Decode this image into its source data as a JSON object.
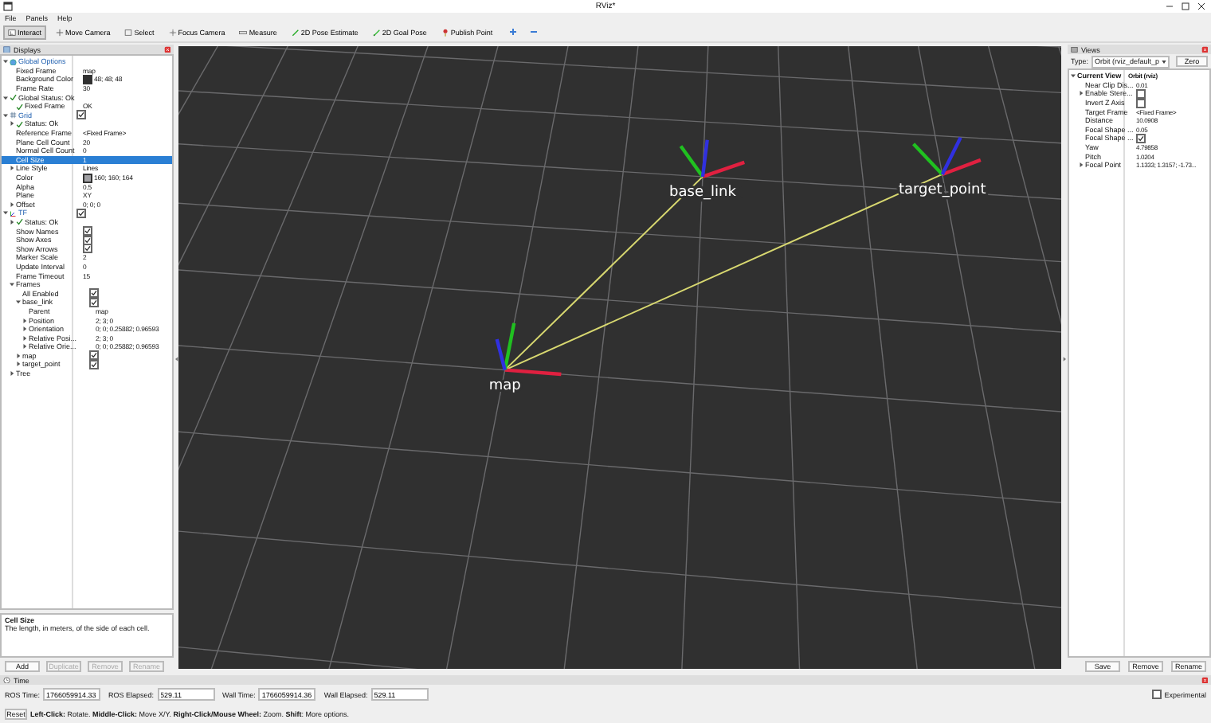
{
  "window": {
    "title": "RViz*"
  },
  "menu": [
    "File",
    "Panels",
    "Help"
  ],
  "toolbar": [
    {
      "label": "Interact",
      "kind": "interact",
      "selected": true
    },
    {
      "label": "Move Camera",
      "kind": "move",
      "selected": false
    },
    {
      "label": "Select",
      "kind": "select",
      "selected": false
    },
    {
      "label": "Focus Camera",
      "kind": "focus",
      "selected": false
    },
    {
      "label": "Measure",
      "kind": "measure",
      "selected": false
    },
    {
      "label": "2D Pose Estimate",
      "kind": "pose",
      "selected": false
    },
    {
      "label": "2D Goal Pose",
      "kind": "goal",
      "selected": false
    },
    {
      "label": "Publish Point",
      "kind": "point",
      "selected": false
    }
  ],
  "toolbar_extra": [
    {
      "kind": "add"
    },
    {
      "kind": "remove"
    }
  ],
  "displays": {
    "title": "Displays",
    "tree": [
      {
        "label": "Global Options",
        "kind": "globe",
        "expanded": true,
        "selected": false,
        "children": [
          {
            "label": "Fixed Frame",
            "value": "map",
            "selected": false
          },
          {
            "label": "Background Color",
            "value": "48; 48; 48",
            "color": "#303030",
            "selected": false
          },
          {
            "label": "Frame Rate",
            "value": "30",
            "selected": false
          }
        ]
      },
      {
        "label": "Global Status: Ok",
        "kind": "status",
        "expanded": true,
        "selected": false,
        "children": [
          {
            "label": "Fixed Frame",
            "kind": "status",
            "value": "OK",
            "selected": false
          }
        ]
      },
      {
        "label": "Grid",
        "kind": "grid",
        "expanded": true,
        "checked": true,
        "selected": false,
        "children": [
          {
            "label": "Status: Ok",
            "kind": "status",
            "expanded": false,
            "selected": false
          },
          {
            "label": "Reference Frame",
            "value": "<Fixed Frame>",
            "selected": false
          },
          {
            "label": "Plane Cell Count",
            "value": "20",
            "selected": false
          },
          {
            "label": "Normal Cell Count",
            "value": "0",
            "selected": false
          },
          {
            "label": "Cell Size",
            "value": "1",
            "selected": true
          },
          {
            "label": "Line Style",
            "value": "Lines",
            "expanded": false,
            "selected": false
          },
          {
            "label": "Color",
            "value": "160; 160; 164",
            "color": "#a0a0a4",
            "selected": false
          },
          {
            "label": "Alpha",
            "value": "0.5",
            "selected": false
          },
          {
            "label": "Plane",
            "value": "XY",
            "selected": false
          },
          {
            "label": "Offset",
            "value": "0; 0; 0",
            "expanded": false,
            "selected": false
          }
        ]
      },
      {
        "label": "TF",
        "kind": "tf",
        "expanded": true,
        "checked": true,
        "selected": false,
        "children": [
          {
            "label": "Status: Ok",
            "kind": "status",
            "expanded": false,
            "selected": false
          },
          {
            "label": "Show Names",
            "checked": true,
            "selected": false
          },
          {
            "label": "Show Axes",
            "checked": true,
            "selected": false
          },
          {
            "label": "Show Arrows",
            "checked": true,
            "selected": false
          },
          {
            "label": "Marker Scale",
            "value": "2",
            "selected": false
          },
          {
            "label": "Update Interval",
            "value": "0",
            "selected": false
          },
          {
            "label": "Frame Timeout",
            "value": "15",
            "selected": false
          },
          {
            "label": "Frames",
            "expanded": true,
            "selected": false,
            "children": [
              {
                "label": "All Enabled",
                "checked": true,
                "selected": false
              },
              {
                "label": "base_link",
                "checked": true,
                "expanded": true,
                "selected": false,
                "children": [
                  {
                    "label": "Parent",
                    "value": "map",
                    "selected": false
                  },
                  {
                    "label": "Position",
                    "value": "2; 3; 0",
                    "expanded": false,
                    "selected": false
                  },
                  {
                    "label": "Orientation",
                    "value": "0; 0; 0.25882; 0.96593",
                    "expanded": false,
                    "selected": false
                  },
                  {
                    "label": "Relative Posi...",
                    "value": "2; 3; 0",
                    "expanded": false,
                    "selected": false
                  },
                  {
                    "label": "Relative Orie...",
                    "value": "0; 0; 0.25882; 0.96593",
                    "expanded": false,
                    "selected": false
                  }
                ]
              },
              {
                "label": "map",
                "checked": true,
                "expanded": false,
                "selected": false
              },
              {
                "label": "target_point",
                "checked": true,
                "expanded": false,
                "selected": false
              }
            ]
          },
          {
            "label": "Tree",
            "expanded": false,
            "selected": false
          }
        ]
      }
    ],
    "help_title": "Cell Size",
    "help_text": "The length, in meters, of the side of each cell.",
    "buttons": [
      {
        "label": "Add",
        "disabled": false
      },
      {
        "label": "Duplicate",
        "disabled": true
      },
      {
        "label": "Remove",
        "disabled": true
      },
      {
        "label": "Rename",
        "disabled": true
      }
    ]
  },
  "scene": {
    "frame_labels": [
      "base_link",
      "target_point",
      "map"
    ]
  },
  "views": {
    "title": "Views",
    "type_label": "Type:",
    "type_value": "Orbit (rviz_default_p",
    "zero_button": "Zero",
    "tree": [
      {
        "label": "Current View",
        "value": "Orbit (rviz)",
        "expanded": true,
        "selected": false,
        "children": [
          {
            "label": "Near Clip Dis...",
            "value": "0.01",
            "selected": false
          },
          {
            "label": "Enable Stere...",
            "checked": false,
            "expanded": false,
            "selected": false
          },
          {
            "label": "Invert Z Axis",
            "checked": false,
            "selected": false
          },
          {
            "label": "Target Frame",
            "value": "<Fixed Frame>",
            "selected": false
          },
          {
            "label": "Distance",
            "value": "10.0908",
            "selected": false
          },
          {
            "label": "Focal Shape ...",
            "value": "0.05",
            "selected": false
          },
          {
            "label": "Focal Shape ...",
            "checked": true,
            "selected": false
          },
          {
            "label": "Yaw",
            "value": "4.79858",
            "selected": false
          },
          {
            "label": "Pitch",
            "value": "1.0204",
            "selected": false
          },
          {
            "label": "Focal Point",
            "value": "1.1333; 1.3157; -1.73...",
            "expanded": false,
            "selected": false
          }
        ]
      }
    ],
    "buttons": [
      "Save",
      "Remove",
      "Rename"
    ]
  },
  "time": {
    "title": "Time",
    "fields": [
      {
        "label": "ROS Time:",
        "value": "1766059914.33"
      },
      {
        "label": "ROS Elapsed:",
        "value": "529.11"
      },
      {
        "label": "Wall Time:",
        "value": "1766059914.36"
      },
      {
        "label": "Wall Elapsed:",
        "value": "529.11"
      }
    ],
    "experimental": {
      "label": "Experimental",
      "checked": false
    },
    "reset_button": "Reset",
    "hint": "**Left-Click:** Rotate. **Middle-Click:** Move X/Y. **Right-Click/Mouse Wheel:** Zoom. **Shift**: More options."
  }
}
